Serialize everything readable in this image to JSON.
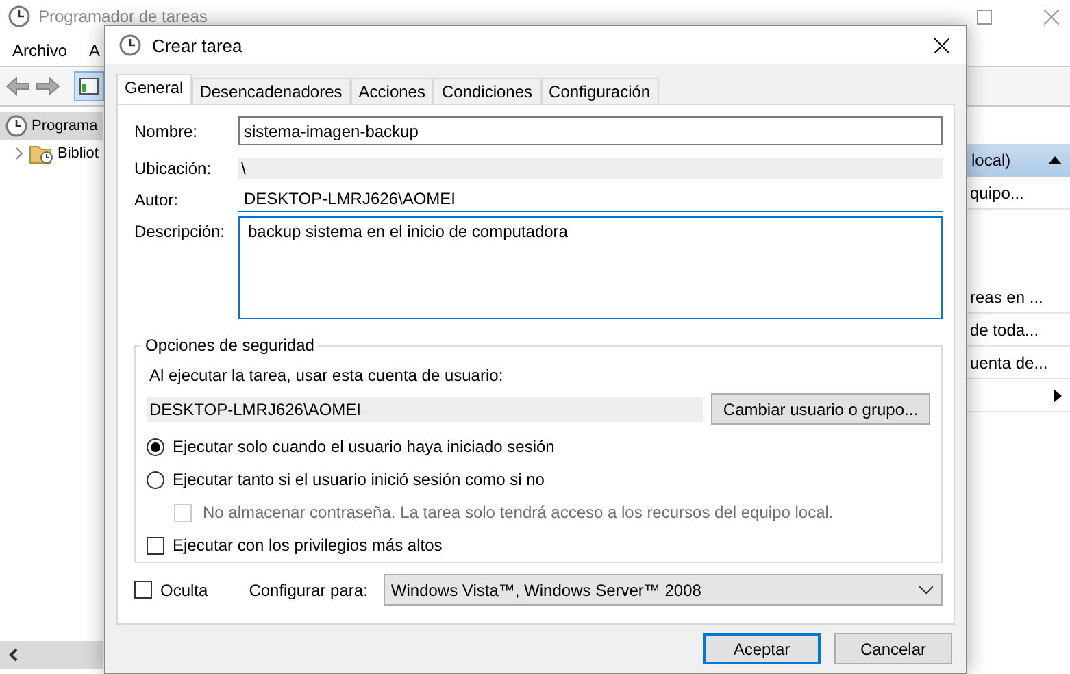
{
  "background_window": {
    "title": "Programador de tareas",
    "menu": [
      "Archivo",
      "A"
    ],
    "tree": [
      {
        "label": "Programa",
        "selected": true,
        "children": [
          {
            "label": "Bibliot",
            "selected": false
          }
        ]
      }
    ],
    "actions": [
      {
        "kind": "header",
        "label": "local)"
      },
      {
        "kind": "item",
        "label": "quipo..."
      },
      {
        "kind": "spacer"
      },
      {
        "kind": "item",
        "label": "reas en ..."
      },
      {
        "kind": "item",
        "label": "de toda..."
      },
      {
        "kind": "item",
        "label": "uenta de..."
      },
      {
        "kind": "submenu"
      },
      {
        "kind": "spacer"
      }
    ]
  },
  "dialog": {
    "title": "Crear tarea",
    "tabs": [
      {
        "label": "General",
        "selected": true
      },
      {
        "label": "Desencadenadores",
        "selected": false
      },
      {
        "label": "Acciones",
        "selected": false
      },
      {
        "label": "Condiciones",
        "selected": false
      },
      {
        "label": "Configuración",
        "selected": false
      }
    ],
    "name": {
      "label": "Nombre:",
      "value": "sistema-imagen-backup"
    },
    "location": {
      "label": "Ubicación:",
      "value": "\\"
    },
    "author": {
      "label": "Autor:",
      "value": "DESKTOP-LMRJ626\\AOMEI"
    },
    "description": {
      "label": "Descripción:",
      "value": "backup sistema en el inicio de computadora"
    },
    "security": {
      "title": "Opciones de seguridad",
      "prompt": "Al ejecutar la tarea, usar esta cuenta de usuario:",
      "account": "DESKTOP-LMRJ626\\AOMEI",
      "change_button": "Cambiar usuario o grupo...",
      "options": [
        {
          "kind": "radio",
          "label": "Ejecutar solo cuando el usuario haya iniciado sesión",
          "selected": true,
          "disabled": false
        },
        {
          "kind": "radio",
          "label": "Ejecutar tanto si el usuario inició sesión como si no",
          "selected": false,
          "disabled": false,
          "children": [
            {
              "kind": "checkbox",
              "label": "No almacenar contraseña. La tarea solo tendrá acceso a los recursos del equipo local.",
              "checked": false,
              "disabled": true
            }
          ]
        },
        {
          "kind": "checkbox",
          "label": "Ejecutar con los privilegios más altos",
          "checked": false,
          "disabled": false
        }
      ]
    },
    "hidden": {
      "label": "Oculta",
      "checked": false
    },
    "configure": {
      "label": "Configurar para:",
      "value": "Windows Vista™, Windows Server™ 2008"
    },
    "buttons": [
      {
        "label": "Aceptar",
        "default": true
      },
      {
        "label": "Cancelar",
        "default": false
      }
    ]
  }
}
